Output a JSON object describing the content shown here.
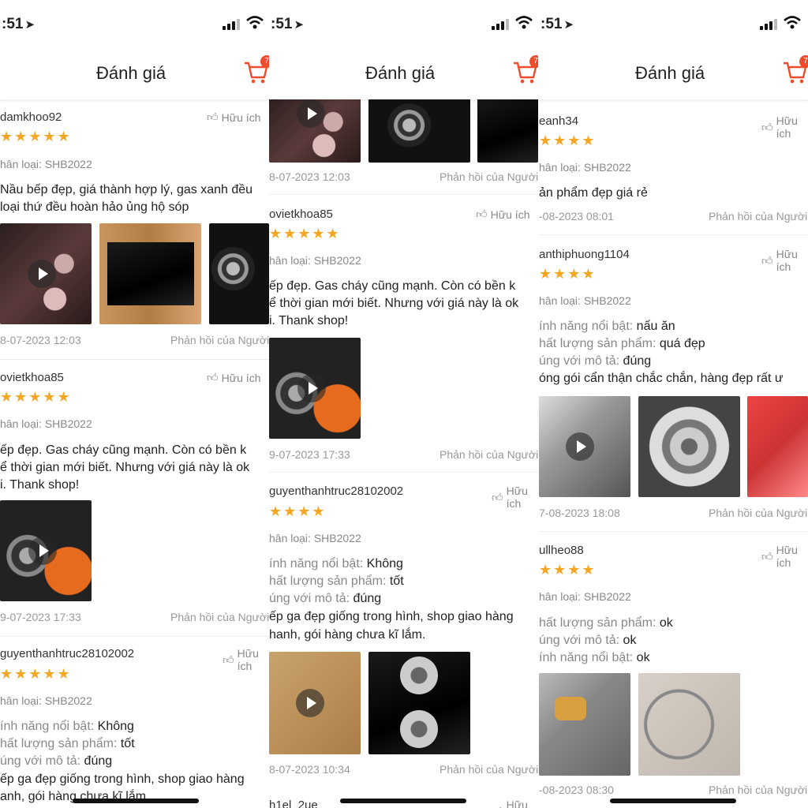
{
  "status": {
    "time": ":51",
    "location_icon": "location-arrow-icon"
  },
  "header": {
    "title": "Đánh giá",
    "cart_count": "7"
  },
  "helpful_label": "Hữu ích",
  "reply_label": "Phản hồi của Người",
  "col1": {
    "r1": {
      "user": "damkhoo92",
      "stars": "★★★★★",
      "variant": "hân loại: SHB2022",
      "line1": "Nầu bếp đẹp, giá thành hợp lý, gas xanh đều",
      "line2": "loại thứ đều hoàn hảo ủng hộ sóp",
      "date": "8-07-2023 12:03"
    },
    "r2": {
      "user": "ovietkhoa85",
      "stars": "★★★★★",
      "variant": "hân loại: SHB2022",
      "line1": "ếp đẹp. Gas cháy cũng mạnh. Còn có bền k",
      "line2": "ể thời gian mới biết. Nhưng với giá này là ok",
      "line3": "i. Thank shop!",
      "date": "9-07-2023 17:33"
    },
    "r3": {
      "user": "guyenthanhtruc28102002",
      "stars": "★★★★★",
      "variant": "hân loại: SHB2022",
      "f1_label": "ính năng nổi bật:",
      "f1_value": "Không",
      "f2_label": "hất lượng sản phẩm:",
      "f2_value": "tốt",
      "f3_label": "úng với mô tả:",
      "f3_value": "đúng",
      "line1": "ếp ga đẹp giống trong hình, shop giao hàng",
      "line2": "anh, gói hàng chưa kĩ lắm."
    }
  },
  "col2": {
    "r1": {
      "date": "8-07-2023 12:03"
    },
    "r2": {
      "user": "ovietkhoa85",
      "stars": "★★★★★",
      "variant": "hân loại: SHB2022",
      "line1": "ếp đẹp. Gas cháy cũng mạnh. Còn có bền k",
      "line2": "ể thời gian mới biết. Nhưng với giá này là ok",
      "line3": "i. Thank shop!",
      "date": "9-07-2023 17:33"
    },
    "r3": {
      "user": "guyenthanhtruc28102002",
      "stars": "★★★★",
      "variant": "hân loại: SHB2022",
      "f1_label": "ính năng nổi bật:",
      "f1_value": "Không",
      "f2_label": "hất lượng sản phẩm:",
      "f2_value": "tốt",
      "f3_label": "úng với mô tả:",
      "f3_value": "đúng",
      "line1": "ếp ga đẹp giống trong hình, shop giao hàng",
      "line2": "hanh, gói hàng chưa kĩ lắm.",
      "date": "8-07-2023 10:34"
    },
    "r4": {
      "user": "h1el_2ue"
    }
  },
  "col3": {
    "r1": {
      "user": "eanh34",
      "stars": "★★★★",
      "variant": "hân loại: SHB2022",
      "line1": "ản phẩm đẹp giá rẻ",
      "date": "-08-2023 08:01"
    },
    "r2": {
      "user": "anthiphuong1104",
      "stars": "★★★★",
      "variant": "hân loại: SHB2022",
      "f1_label": "ính năng nổi bật:",
      "f1_value": "nấu ăn",
      "f2_label": "hất lượng sản phẩm:",
      "f2_value": "quá đẹp",
      "f3_label": "úng với mô tả:",
      "f3_value": "đúng",
      "line1": "óng gói cẩn thận chắc chắn, hàng đẹp rất ư",
      "date": "7-08-2023 18:08"
    },
    "r3": {
      "user": "ullheo88",
      "stars": "★★★★",
      "variant": "hân loại: SHB2022",
      "f2_label": "hất lượng sản phẩm:",
      "f2_value": "ok",
      "f3_label": "úng với mô tả:",
      "f3_value": "ok",
      "f1_label": "ính năng nổi bật:",
      "f1_value": "ok",
      "date": "-08-2023 08:30"
    }
  }
}
